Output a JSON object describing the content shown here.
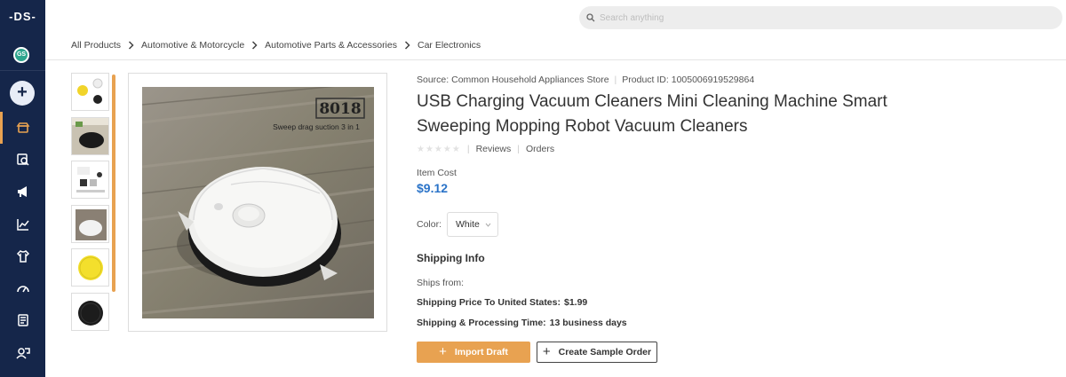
{
  "sidebar": {
    "logo": "-DS-",
    "avatar_initials": "GS",
    "add_label": "+",
    "items": [
      {
        "icon": "store-icon",
        "active": true
      },
      {
        "icon": "product-search-icon",
        "active": false
      },
      {
        "icon": "megaphone-icon",
        "active": false
      },
      {
        "icon": "chart-icon",
        "active": false
      },
      {
        "icon": "tshirt-icon",
        "active": false
      },
      {
        "icon": "speedometer-icon",
        "active": false
      },
      {
        "icon": "document-icon",
        "active": false
      },
      {
        "icon": "support-icon",
        "active": false
      }
    ],
    "accent": "#e8a251",
    "background": "#15264a"
  },
  "search": {
    "placeholder": "Search anything"
  },
  "breadcrumb": [
    "All Products",
    "Automotive & Motorcycle",
    "Automotive Parts & Accessories",
    "Car Electronics"
  ],
  "product": {
    "source_label": "Source:",
    "source": "Common Household Appliances Store",
    "product_id_label": "Product ID:",
    "product_id": "1005006919529864",
    "title": "USB Charging Vacuum Cleaners Mini Cleaning Machine Smart Sweeping Mopping Robot Vacuum Cleaners",
    "reviews_label": "Reviews",
    "orders_label": "Orders",
    "rating": 0,
    "item_cost_label": "Item Cost",
    "item_cost": "$9.12",
    "color_label": "Color:",
    "color_value": "White",
    "image_badge": "8018",
    "image_caption": "Sweep drag suction 3 in 1"
  },
  "shipping": {
    "title": "Shipping Info",
    "ships_from_label": "Ships from:",
    "price_label": "Shipping Price To United States:",
    "price_value": "$1.99",
    "time_label": "Shipping & Processing Time:",
    "time_value": "13 business days"
  },
  "actions": {
    "import_label": "Import Draft",
    "sample_label": "Create Sample Order"
  },
  "colors": {
    "price": "#2a73c8",
    "primary_button": "#e8a251"
  }
}
